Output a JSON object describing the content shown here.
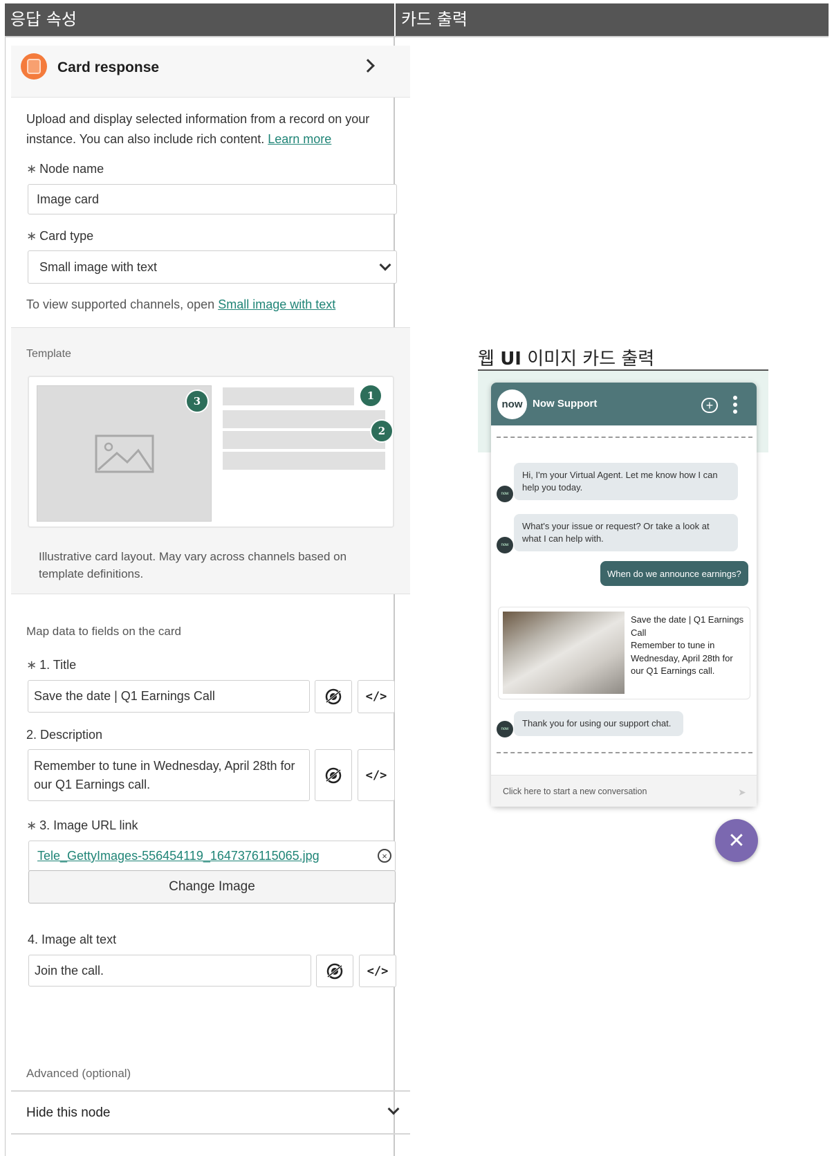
{
  "columns": {
    "left_header": "응답 속성",
    "right_header": "카드 출력"
  },
  "panel": {
    "title": "Card response",
    "description": "Upload and display selected information from a record on your instance. You can also include rich content.",
    "learn_more": "Learn more",
    "node_name_label": "Node name",
    "node_name_value": "Image card",
    "card_type_label": "Card type",
    "card_type_value": "Small image with text",
    "channels_text": "To view supported channels, open",
    "channels_link": "Small image with text",
    "template_label": "Template",
    "template_badges": [
      "3",
      "1",
      "2"
    ],
    "template_caption": "Illustrative card layout. May vary across channels based on template definitions.",
    "map_label": "Map data to fields on the card",
    "title_label": "1. Title",
    "title_value": "Save the date | Q1 Earnings Call",
    "desc_label": "2. Description",
    "desc_value": "Remember to tune in Wednesday, April 28th for our Q1 Earnings call.",
    "image_url_label": "3. Image URL link",
    "image_url_value": "Tele_GettyImages-556454119_1647376115065.jpg",
    "change_image": "Change Image",
    "alt_label": "4. Image alt text",
    "alt_value": "Join the call.",
    "advanced_label": "Advanced (optional)",
    "hide_node": "Hide this node",
    "code_glyph": "</>",
    "required_mark": "∗"
  },
  "preview": {
    "title_prefix": "웹",
    "title_ui": "UI",
    "title_suffix": "이미지 카드 출력",
    "chat_title": "Now Support",
    "logo_text": "now",
    "avatar_text": "now",
    "msg1": "Hi, I'm your Virtual Agent. Let me know how I can help you today.",
    "msg2": "What's your issue or request? Or take a look at what I can help with.",
    "user_msg": "When do we announce earnings?",
    "card_title": "Save the date | Q1 Earnings Call",
    "card_desc": "Remember to tune in Wednesday, April 28th for our Q1 Earnings call.",
    "msg3": "Thank you for using our support chat.",
    "footer": "Click here to start a new conversation",
    "colors": {
      "header": "#4f7679",
      "user_bubble": "#3d6669",
      "fab": "#7b68b0",
      "accent": "#f47b3c",
      "badge": "#2d6e5a",
      "link": "#1f8476"
    }
  }
}
